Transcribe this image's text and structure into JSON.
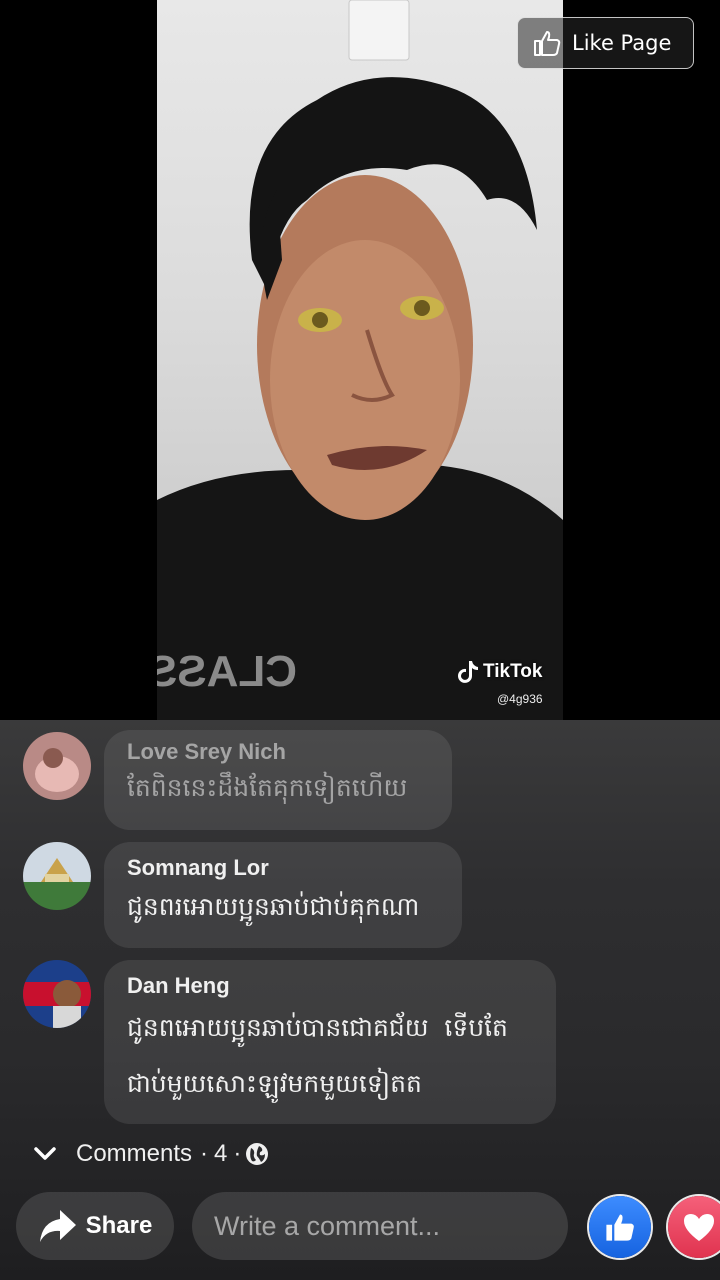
{
  "header": {
    "like_page_label": "Like Page"
  },
  "video": {
    "watermark_brand": "TikTok",
    "watermark_handle": "@4g936",
    "shirt_text": "CLASSIC"
  },
  "comments": [
    {
      "author": "Love Srey Nich",
      "text": "តែពិននេះដឹងតែគុកទៀតហើយ"
    },
    {
      "author": "Somnang Lor",
      "text": "ជូនពរអោយប្អូនឆាប់ជាប់គុកណា"
    },
    {
      "author": "Dan Heng",
      "line1": "ជូនពអោយប្អូនឆាប់បានជោគជ័យ  ទើបតែ",
      "line2": "ជាប់មួយសោះឡូវមកមួយទៀតត"
    }
  ],
  "comments_bar": {
    "label": "Comments",
    "separator": "·",
    "count": "4"
  },
  "bottom": {
    "share_label": "Share",
    "comment_placeholder": "Write a comment..."
  },
  "colors": {
    "like_blue": "#1877f2",
    "love_red": "#f33e58",
    "bubble": "rgba(255,255,255,0.09)"
  },
  "icons": [
    "thumbs-up-icon",
    "share-arrow-icon",
    "chevron-down-icon",
    "globe-icon",
    "heart-icon"
  ]
}
